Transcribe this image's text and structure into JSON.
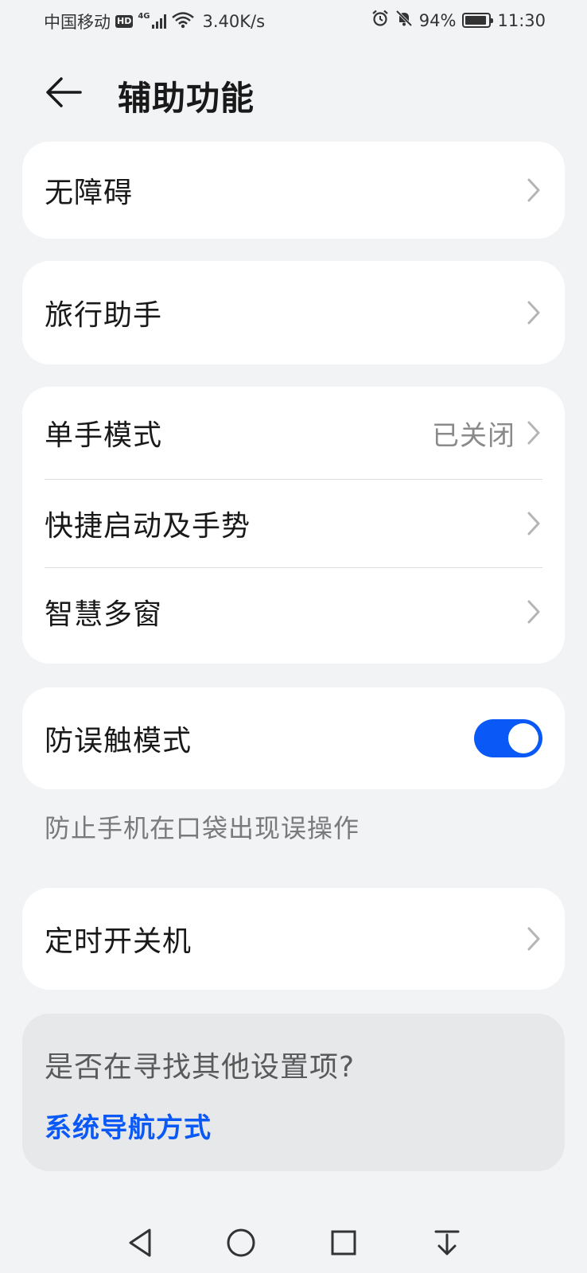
{
  "status_bar": {
    "carrier": "中国移动",
    "hd_badge": "HD",
    "network_type": "4G",
    "speed": "3.40K/s",
    "battery_percent": "94%",
    "battery_level": 0.94,
    "time": "11:30",
    "icons": [
      "hd-icon",
      "signal-icon",
      "wifi-icon",
      "alarm-icon",
      "mute-icon",
      "battery-icon"
    ]
  },
  "header": {
    "title": "辅助功能",
    "back_icon": "arrow-left-icon"
  },
  "cards": [
    {
      "rows": [
        {
          "label": "无障碍"
        }
      ]
    },
    {
      "rows": [
        {
          "label": "旅行助手"
        }
      ]
    },
    {
      "rows": [
        {
          "label": "单手模式",
          "value": "已关闭"
        },
        {
          "label": "快捷启动及手势"
        },
        {
          "label": "智慧多窗"
        }
      ]
    },
    {
      "rows": [
        {
          "label": "防误触模式",
          "toggle": true
        }
      ]
    },
    {
      "rows": [
        {
          "label": "定时开关机"
        }
      ]
    }
  ],
  "pocket_mode_caption": "防止手机在口袋出现误操作",
  "hint": {
    "question": "是否在寻找其他设置项?",
    "link": "系统导航方式"
  },
  "nav_bar": {
    "icons": [
      "back-triangle-icon",
      "home-circle-icon",
      "recents-square-icon",
      "notification-pull-icon"
    ]
  },
  "colors": {
    "background": "#f1f3f5",
    "card": "#ffffff",
    "accent": "#0a59f7",
    "text": "#191919",
    "secondary_text": "#8a8a8a"
  }
}
